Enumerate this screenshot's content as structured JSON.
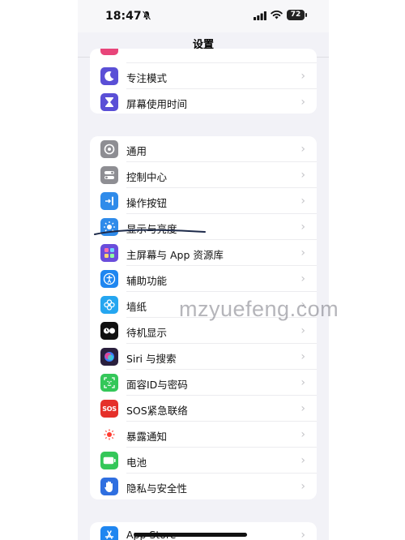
{
  "status_bar": {
    "time": "18:47",
    "battery": "72"
  },
  "nav": {
    "title": "设置"
  },
  "group_top": {
    "items": [
      {
        "label": "专注模式",
        "icon": "moon-icon",
        "color": "#5a4fd6"
      },
      {
        "label": "屏幕使用时间",
        "icon": "hourglass-icon",
        "color": "#5a4fd6"
      }
    ]
  },
  "group_main": {
    "items": [
      {
        "label": "通用",
        "icon": "gear-icon",
        "color": "#8e8e93"
      },
      {
        "label": "控制中心",
        "icon": "toggles-icon",
        "color": "#8e8e93"
      },
      {
        "label": "操作按钮",
        "icon": "action-button-icon",
        "color": "#2f8bea"
      },
      {
        "label": "显示与亮度",
        "icon": "sun-icon",
        "color": "#2f8bea"
      },
      {
        "label": "主屏幕与 App 资源库",
        "icon": "app-grid-icon",
        "color": "#6a4ddb"
      },
      {
        "label": "辅助功能",
        "icon": "accessibility-icon",
        "color": "#1f86f0"
      },
      {
        "label": "墙纸",
        "icon": "flower-icon",
        "color": "#25a6f0"
      },
      {
        "label": "待机显示",
        "icon": "standby-icon",
        "color": "#111111"
      },
      {
        "label": "Siri 与搜索",
        "icon": "siri-icon",
        "color": "#2a1f3d"
      },
      {
        "label": "面容ID与密码",
        "icon": "face-id-icon",
        "color": "#34c759"
      },
      {
        "label": "SOS紧急联络",
        "icon": "sos-icon",
        "color": "#e5302a",
        "glyph": "SOS"
      },
      {
        "label": "暴露通知",
        "icon": "exposure-icon",
        "color": "#ffffff"
      },
      {
        "label": "电池",
        "icon": "battery-icon",
        "color": "#34c759"
      },
      {
        "label": "隐私与安全性",
        "icon": "hand-icon",
        "color": "#2f6fe0"
      }
    ]
  },
  "group_bottom": {
    "items": [
      {
        "label": "App Store",
        "icon": "app-store-icon",
        "color": "#1f86f0"
      }
    ]
  },
  "watermark": "mzyuefeng.com"
}
